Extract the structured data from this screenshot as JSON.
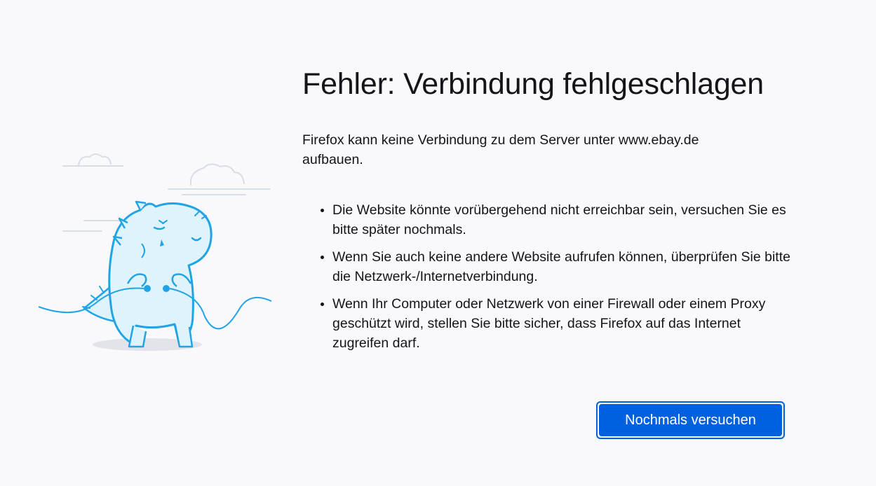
{
  "error_page": {
    "title": "Fehler: Verbindung fehlgeschlagen",
    "intro": "Firefox kann keine Verbindung zu dem Server unter www.ebay.de aufbauen.",
    "reasons": [
      "Die Website könnte vorübergehend nicht erreichbar sein, versuchen Sie es bitte später nochmals.",
      "Wenn Sie auch keine andere Website aufrufen können, überprüfen Sie bitte die Netzwerk-/Internetverbindung.",
      "Wenn Ihr Computer oder Netzwerk von einer Firewall oder einem Proxy geschützt wird, stellen Sie bitte sicher, dass Firefox auf das Internet zugreifen darf."
    ],
    "retry_label": "Nochmals versuchen",
    "illustration_icon": "unplugged-dino-icon"
  },
  "colors": {
    "background": "#f9f9fb",
    "text": "#15141a",
    "accent": "#0061e0",
    "illustration_line": "#20a4e6",
    "illustration_fill": "#dff3fc"
  }
}
